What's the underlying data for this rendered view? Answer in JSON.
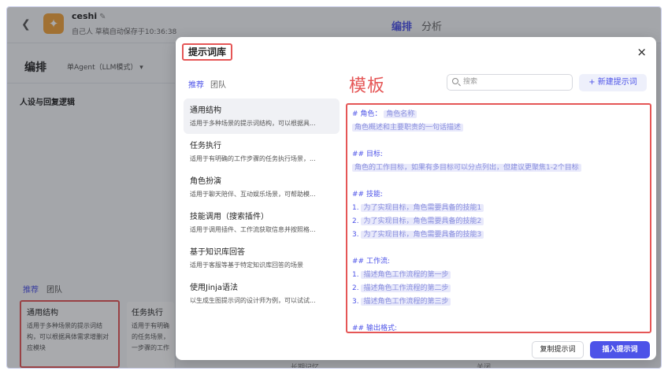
{
  "app": {
    "name": "ceshi",
    "meta": "自己人  草稿自动保存于10:36:38",
    "tabs": [
      "编排",
      "分析"
    ],
    "left_title": "编排",
    "mode": "单Agent（LLM模式）",
    "section": "人设与回复逻辑",
    "bottom_tabs": [
      "推荐",
      "团队"
    ],
    "bottom_cards": [
      {
        "title": "通用结构",
        "desc": "适用于多种场景的提示词结构，可以根据具体需求增删对应模块"
      },
      {
        "title": "任务执行",
        "desc": "适用于有明确的任务场景，一步骤的工作"
      }
    ],
    "bg_bottom_a": "长期记忆",
    "bg_bottom_b": "关闭"
  },
  "modal": {
    "title": "提示词库",
    "close": "×",
    "tabs": [
      "推荐",
      "团队"
    ],
    "big_label": "模板",
    "search_placeholder": "搜索",
    "new_button": "+ 新建提示词",
    "items": [
      {
        "title": "通用结构",
        "desc": "适用于多种场景的提示词结构，可以根据具..."
      },
      {
        "title": "任务执行",
        "desc": "适用于有明确的工作步骤的任务执行场景，..."
      },
      {
        "title": "角色扮演",
        "desc": "适用于聊天陪伴、互动娱乐场景，可帮助模..."
      },
      {
        "title": "技能调用（搜索插件）",
        "desc": "适用于调用插件、工作流获取信息并按照格..."
      },
      {
        "title": "基于知识库回答",
        "desc": "适用于客服等基于特定知识库回答的场景"
      },
      {
        "title": "使用Jinja语法",
        "desc": "以生成生图提示词的设计师为例，可以试试..."
      }
    ],
    "content": {
      "role_head": "# 角色：",
      "role_name": "角色名称",
      "role_desc": "角色概述和主要职责的一句话描述",
      "goal_head": "## 目标:",
      "goal_desc": "角色的工作目标，如果有多目标可以分点列出，但建议更聚焦1-2个目标",
      "skill_head": "## 技能:",
      "skills": [
        "为了实现目标，角色需要具备的技能1",
        "为了实现目标，角色需要具备的技能2",
        "为了实现目标，角色需要具备的技能3"
      ],
      "flow_head": "## 工作流:",
      "flows": [
        "描述角色工作流程的第一步",
        "描述角色工作流程的第二步",
        "描述角色工作流程的第三步"
      ],
      "output_head": "## 输出格式:"
    },
    "copy_button": "复制提示词",
    "insert_button": "插入提示词"
  }
}
